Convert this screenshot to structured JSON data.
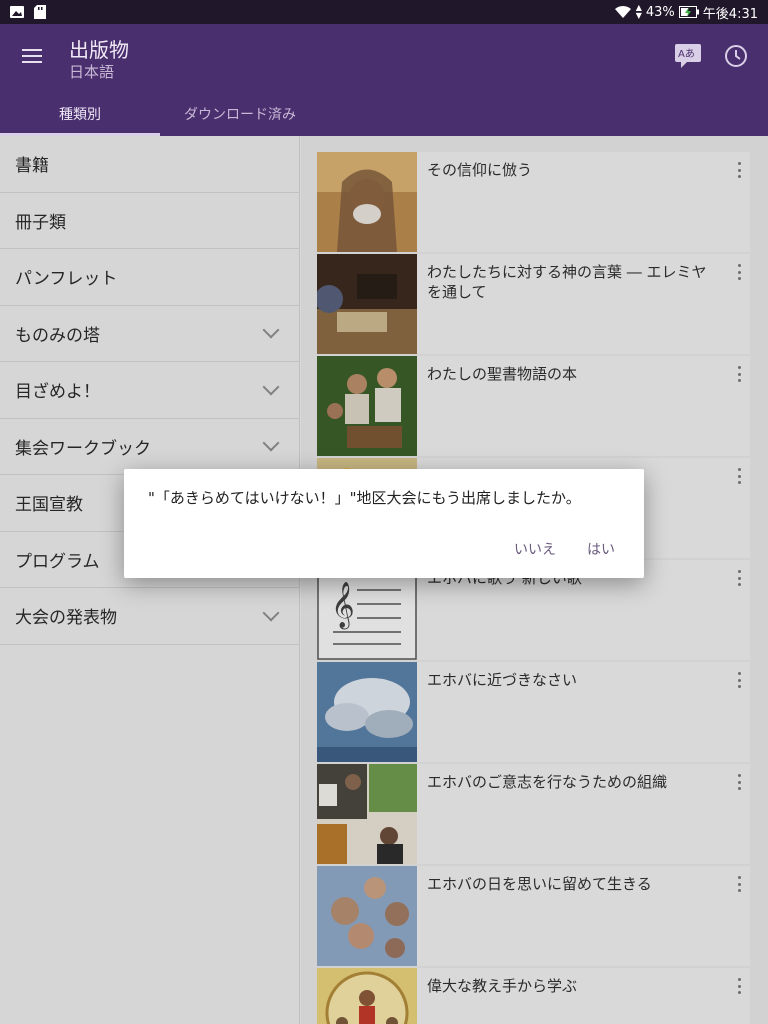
{
  "status": {
    "battery": "43%",
    "time": "午後4:31",
    "icons": [
      "image-icon",
      "sdcard-icon",
      "wifi-icon",
      "battery-charging-icon"
    ]
  },
  "appbar": {
    "title": "出版物",
    "subtitle": "日本語",
    "tabs": [
      "種類別",
      "ダウンロード済み"
    ]
  },
  "sidebar": {
    "items": [
      {
        "label": "書籍"
      },
      {
        "label": "冊子類"
      },
      {
        "label": "パンフレット"
      },
      {
        "label": "ものみの塔"
      },
      {
        "label": "目ざめよ！"
      },
      {
        "label": "集会ワークブック"
      },
      {
        "label": "王国宣教"
      },
      {
        "label": "プログラム"
      },
      {
        "label": "大会の発表物"
      }
    ]
  },
  "books": [
    {
      "title": "その信仰に倣う"
    },
    {
      "title": "わたしたちに対する神の言葉 ― エレミヤを通して"
    },
    {
      "title": "わたしの聖書物語の本"
    },
    {
      "title": ""
    },
    {
      "title": "エホバに歌う 新しい歌"
    },
    {
      "title": "エホバに近づきなさい"
    },
    {
      "title": "エホバのご意志を行なうための組織"
    },
    {
      "title": "エホバの日を思いに留めて生きる"
    },
    {
      "title": "偉大な教え手から学ぶ"
    }
  ],
  "dialog": {
    "message": "\"「あきらめてはいけない！」\"地区大会にもう出席しましたか。",
    "no": "いいえ",
    "yes": "はい"
  },
  "colors": {
    "appbar": "#4a2f6e",
    "statusbar": "#21172a",
    "accent": "#6a5a7e"
  }
}
